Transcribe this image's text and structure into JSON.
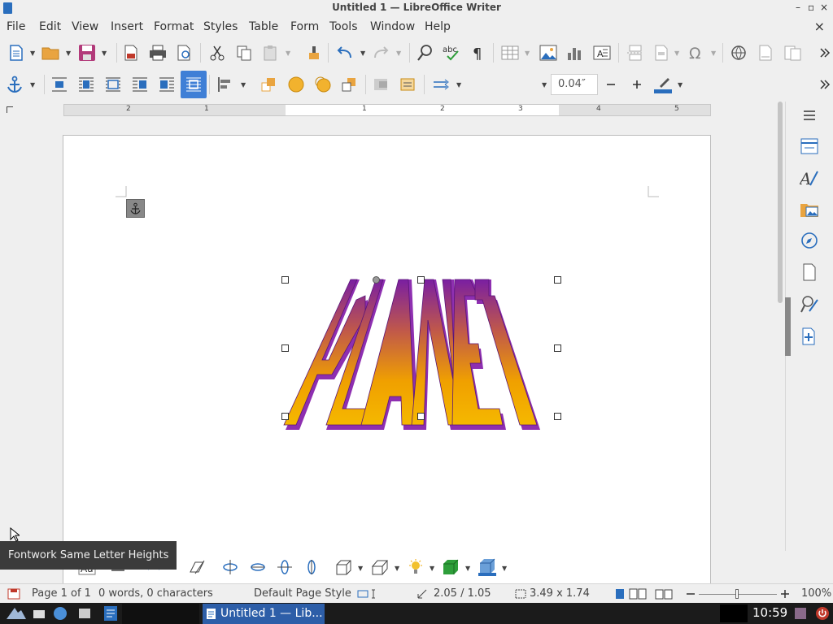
{
  "window": {
    "title": "Untitled 1 — LibreOffice Writer",
    "controls": [
      "–",
      "▫",
      "×"
    ]
  },
  "menubar": {
    "items": [
      "File",
      "Edit",
      "View",
      "Insert",
      "Format",
      "Styles",
      "Table",
      "Form",
      "Tools",
      "Window",
      "Help"
    ],
    "close_doc": "×"
  },
  "toolbar2": {
    "line_width": "0.04″"
  },
  "ruler": {
    "labels": [
      "2",
      "1",
      "1",
      "2",
      "3",
      "4",
      "5"
    ]
  },
  "fontwork": {
    "text": "PLANET",
    "colors": {
      "top": "#7a1fa2",
      "front": "#f5a800",
      "side": "#8e2fb0"
    }
  },
  "tooltip": {
    "text": "Fontwork Same Letter Heights"
  },
  "statusbar": {
    "page": "Page 1 of 1",
    "words": "0 words, 0 characters",
    "page_style": "Default Page Style",
    "position": "2.05 / 1.05",
    "size": "3.49 x 1.74",
    "zoom": "100%"
  },
  "taskbar": {
    "task_label": "Untitled 1 — Lib...",
    "clock": "10:59"
  }
}
